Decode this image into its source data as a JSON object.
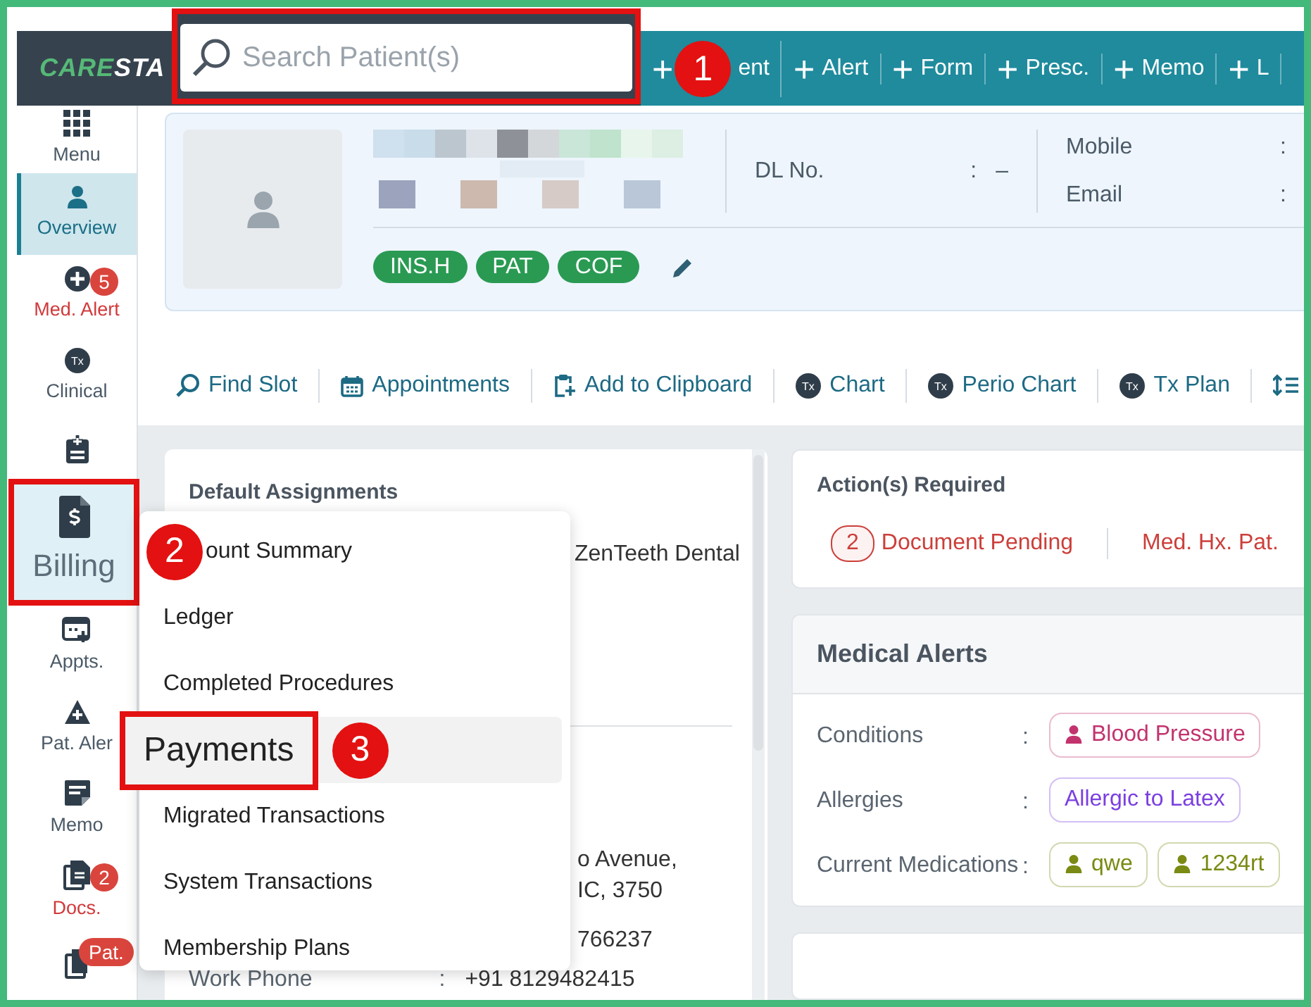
{
  "topbar": {
    "logo_primary": "CARE",
    "logo_secondary": "STA",
    "search": {
      "placeholder": "Search Patient(s)"
    },
    "actions": [
      {
        "symbol": "+",
        "label": "ent",
        "callout": "1"
      },
      {
        "symbol": "+",
        "label": "Alert"
      },
      {
        "symbol": "+",
        "label": "Form"
      },
      {
        "symbol": "+",
        "label": "Presc."
      },
      {
        "symbol": "+",
        "label": "Memo"
      },
      {
        "symbol": "+",
        "label": "L"
      }
    ]
  },
  "sidebar": {
    "items": [
      {
        "kind": "grid",
        "label": "Menu",
        "selected": false,
        "expanded": false,
        "highlighted": false,
        "alert": false
      },
      {
        "kind": "person",
        "label": "Overview",
        "selected": true,
        "expanded": false,
        "highlighted": false,
        "alert": false
      },
      {
        "kind": "plus-circle",
        "label": "Med. Alert",
        "badge": "5",
        "selected": false,
        "expanded": false,
        "highlighted": false,
        "alert": true
      },
      {
        "kind": "tx",
        "icon_text": "Tx",
        "label": "Clinical",
        "selected": false,
        "expanded": false,
        "highlighted": false,
        "alert": false
      },
      {
        "kind": "clipboard",
        "selected": false,
        "expanded": false,
        "highlighted": false
      },
      {
        "kind": "invoice",
        "label": "Billing",
        "selected": false,
        "expanded": true,
        "highlighted": true,
        "alert": false
      },
      {
        "kind": "calendar-plus",
        "label": "Appts.",
        "selected": false,
        "expanded": false,
        "highlighted": false,
        "alert": false
      },
      {
        "kind": "warning",
        "label": "Pat. Aler",
        "selected": false,
        "expanded": false,
        "highlighted": false,
        "alert": false
      },
      {
        "kind": "note",
        "label": "Memo",
        "selected": false,
        "expanded": false,
        "highlighted": false,
        "alert": false
      },
      {
        "kind": "document",
        "label": "Docs.",
        "badge": "2",
        "selected": false,
        "expanded": false,
        "highlighted": false,
        "alert": true
      },
      {
        "kind": "medical-history",
        "badge": "Pat.",
        "selected": false,
        "expanded": false,
        "highlighted": false
      }
    ]
  },
  "billing_menu": {
    "items": [
      {
        "label": "ount Summary",
        "callout": "2",
        "selected": false,
        "highlighted": false
      },
      {
        "label": "Ledger",
        "selected": false,
        "highlighted": false
      },
      {
        "label": "Completed Procedures",
        "selected": false,
        "highlighted": false
      },
      {
        "label": "Payments",
        "callout": "3",
        "selected": true,
        "highlighted": true
      },
      {
        "label": "Migrated Transactions",
        "selected": false,
        "highlighted": false
      },
      {
        "label": "System Transactions",
        "selected": false,
        "highlighted": false
      },
      {
        "label": "Membership Plans",
        "selected": false,
        "highlighted": false
      }
    ]
  },
  "patient": {
    "tags": [
      "INS.H",
      "PAT",
      "COF"
    ],
    "fields": [
      {
        "label": "DL No.",
        "colon": ":",
        "value": "–"
      }
    ],
    "contacts": [
      {
        "label": "Mobile",
        "colon": ":"
      },
      {
        "label": "Email",
        "colon": ":"
      }
    ]
  },
  "toolbar": [
    {
      "kind": "search",
      "label": "Find Slot"
    },
    {
      "kind": "calendar",
      "label": "Appointments"
    },
    {
      "kind": "clipboard-add",
      "label": "Add to Clipboard"
    },
    {
      "kind": "tx",
      "icon_text": "Tx",
      "label": "Chart"
    },
    {
      "kind": "tx",
      "icon_text": "Tx",
      "label": "Perio Chart"
    },
    {
      "kind": "tx",
      "icon_text": "Tx",
      "label": "Tx Plan"
    },
    {
      "kind": "sort"
    }
  ],
  "default_assignments": {
    "title": "Default Assignments",
    "values": [
      "ZenTeeth Dental"
    ],
    "address_lines": [
      "o Avenue,",
      "IC, 3750"
    ],
    "phone": "766237",
    "work_phone": {
      "label": "Work Phone",
      "colon": ":",
      "value": "+91 8129482415"
    }
  },
  "actions_required": {
    "title": "Action(s) Required",
    "items": [
      {
        "count": "2",
        "label": "Document Pending"
      },
      {
        "label": "Med. Hx. Pat."
      }
    ]
  },
  "medical_alerts": {
    "title": "Medical Alerts",
    "rows": [
      {
        "label": "Conditions",
        "colon": ":",
        "chips": [
          {
            "kind": "person",
            "label": "Blood Pressure",
            "color": "#c2336e"
          }
        ]
      },
      {
        "label": "Allergies",
        "colon": ":",
        "chips": [
          {
            "kind": "plain",
            "label": "Allergic to Latex",
            "color": "#7b3fe0"
          }
        ]
      },
      {
        "label": "Current Medications",
        "colon": ":",
        "chips": [
          {
            "kind": "person",
            "label": "qwe",
            "color": "#7a8a12"
          },
          {
            "kind": "person",
            "label": "1234rt",
            "color": "#7a8a12"
          }
        ]
      }
    ]
  }
}
